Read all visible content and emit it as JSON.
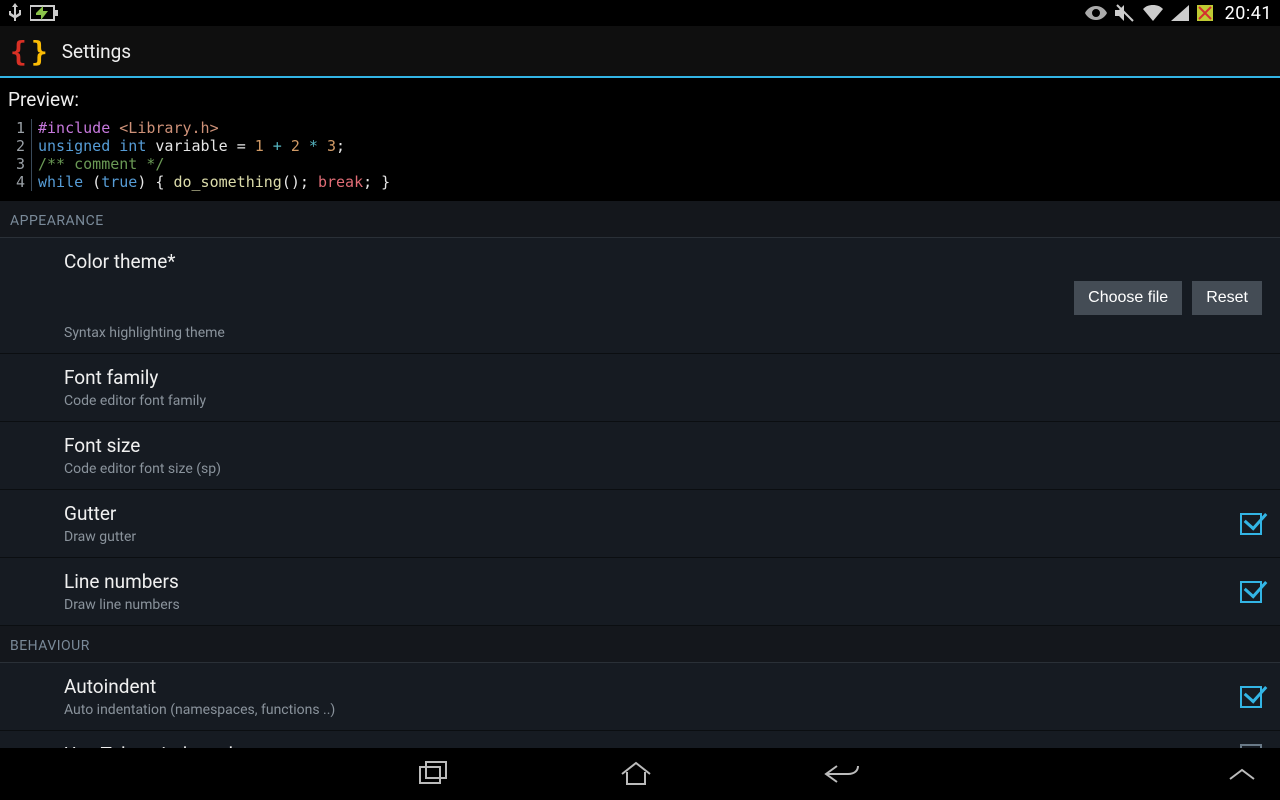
{
  "statusbar": {
    "time": "20:41"
  },
  "actionbar": {
    "title": "Settings"
  },
  "preview": {
    "label": "Preview:",
    "lines": [
      "1",
      "2",
      "3",
      "4"
    ],
    "l1_inc": "#include",
    "l1_lib": " <Library.h>",
    "l2_kw1": "unsigned",
    "l2_kw2": " int",
    "l2_var": " variable ",
    "l2_eq": "= ",
    "l2_n1": "1",
    "l2_op1": " + ",
    "l2_n2": "2",
    "l2_op2": " * ",
    "l2_n3": "3",
    "l2_end": ";",
    "l3_com": "/** comment */",
    "l4_kw": "while",
    "l4_p1": " (",
    "l4_true": "true",
    "l4_p2": ") { ",
    "l4_fn": "do_something",
    "l4_call": "(); ",
    "l4_br": "break",
    "l4_p3": "; }"
  },
  "sections": {
    "appearance": "Appearance",
    "behaviour": "Behaviour"
  },
  "prefs": {
    "color_theme": {
      "title": "Color theme*",
      "summary": "Syntax highlighting theme",
      "choose": "Choose file",
      "reset": "Reset"
    },
    "font_family": {
      "title": "Font family",
      "summary": "Code editor font family"
    },
    "font_size": {
      "title": "Font size",
      "summary": "Code editor font size (sp)"
    },
    "gutter": {
      "title": "Gutter",
      "summary": "Draw gutter",
      "checked": true
    },
    "line_numbers": {
      "title": "Line numbers",
      "summary": "Draw line numbers",
      "checked": true
    },
    "autoindent": {
      "title": "Autoindent",
      "summary": "Auto indentation (namespaces, functions ..)",
      "checked": true
    },
    "use_tab": {
      "title": "Use Tab as indent char",
      "summary": "",
      "checked": false
    }
  }
}
